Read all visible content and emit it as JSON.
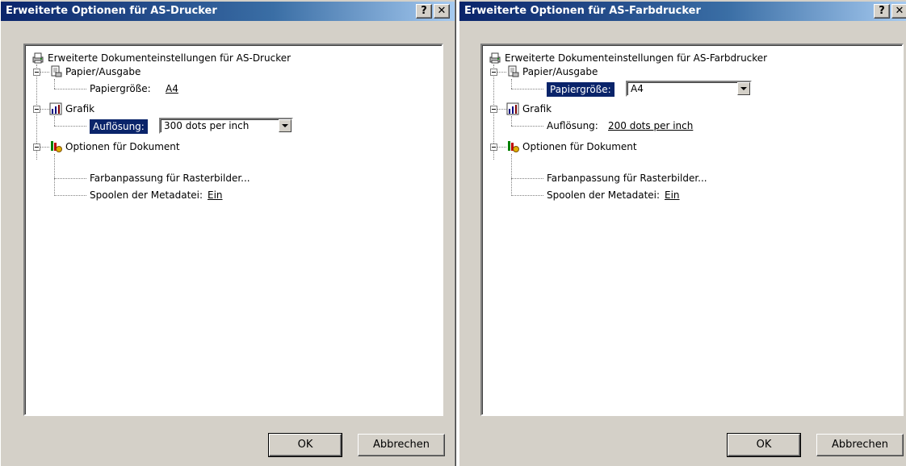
{
  "dialog1": {
    "title": "Erweiterte Optionen für AS-Drucker",
    "help_label": "?",
    "close_label": "✕",
    "tree": {
      "root": "Erweiterte Dokumenteinstellungen für AS-Drucker",
      "paper_group": "Papier/Ausgabe",
      "paper_size_label": "Papiergröße:",
      "paper_size_value": "A4",
      "graphics_group": "Grafik",
      "resolution_label": "Auflösung:",
      "resolution_value": "300 dots per inch",
      "options_group": "Optionen für Dokument",
      "color_matching": "Farbanpassung für Rasterbilder...",
      "spool_label": "Spoolen der Metadatei:",
      "spool_value": "Ein"
    },
    "ok_label": "OK",
    "cancel_label": "Abbrechen"
  },
  "dialog2": {
    "title": "Erweiterte Optionen für AS-Farbdrucker",
    "help_label": "?",
    "close_label": "✕",
    "tree": {
      "root": "Erweiterte Dokumenteinstellungen für AS-Farbdrucker",
      "paper_group": "Papier/Ausgabe",
      "paper_size_label": "Papiergröße:",
      "paper_size_value": "A4",
      "graphics_group": "Grafik",
      "resolution_label": "Auflösung:",
      "resolution_value": "200 dots per inch",
      "options_group": "Optionen für Dokument",
      "color_matching": "Farbanpassung für Rasterbilder...",
      "spool_label": "Spoolen der Metadatei:",
      "spool_value": "Ein"
    },
    "ok_label": "OK",
    "cancel_label": "Abbrechen"
  },
  "colors": {
    "titlebar_start": "#0a246a",
    "titlebar_end": "#a6caf0",
    "window_face": "#d4d0c8",
    "selection": "#0a246a"
  },
  "icons": {
    "root": "printer-icon",
    "paper": "paper-output-icon",
    "graphics": "bar-chart-icon",
    "options": "document-options-icon"
  }
}
